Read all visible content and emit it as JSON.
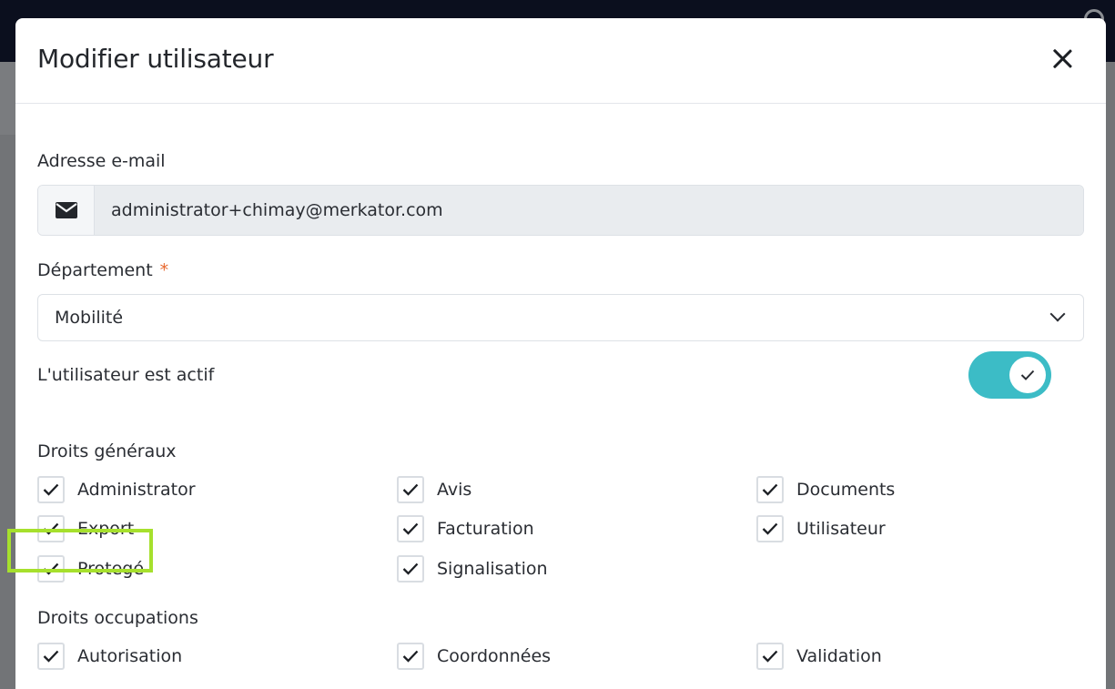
{
  "modal": {
    "title": "Modifier utilisateur"
  },
  "email": {
    "label": "Adresse e-mail",
    "value": "administrator+chimay@merkator.com",
    "icon": "envelope-icon"
  },
  "department": {
    "label": "Département",
    "required_mark": "*",
    "selected": "Mobilité"
  },
  "active": {
    "label": "L'utilisateur est actif",
    "enabled": true,
    "accent_color": "#3cbcc6"
  },
  "general_rights": {
    "heading": "Droits généraux",
    "items": [
      {
        "label": "Administrator",
        "checked": true
      },
      {
        "label": "Avis",
        "checked": true
      },
      {
        "label": "Documents",
        "checked": true
      },
      {
        "label": "Export",
        "checked": true
      },
      {
        "label": "Facturation",
        "checked": true
      },
      {
        "label": "Utilisateur",
        "checked": true
      },
      {
        "label": "Protegé",
        "checked": true
      },
      {
        "label": "Signalisation",
        "checked": true
      }
    ]
  },
  "occupation_rights": {
    "heading": "Droits occupations",
    "items": [
      {
        "label": "Autorisation",
        "checked": true
      },
      {
        "label": "Coordonnées",
        "checked": true
      },
      {
        "label": "Validation",
        "checked": true
      }
    ]
  },
  "highlight_color": "#a6e02d"
}
